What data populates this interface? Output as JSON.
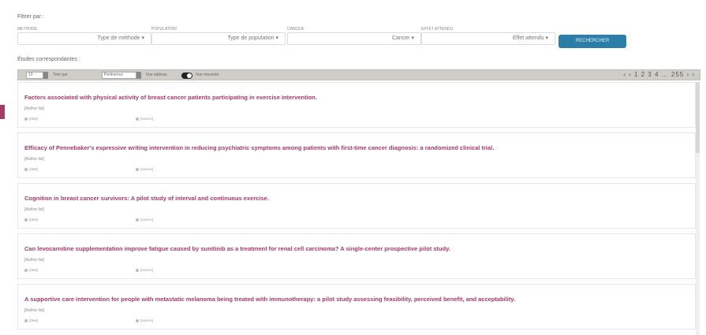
{
  "filters": {
    "title": "Filtrer par :",
    "columns": [
      {
        "label": "METHODE",
        "select": "Type de méthode ▾"
      },
      {
        "label": "POPULATION",
        "select": "Type de population ▾"
      },
      {
        "label": "CANCER",
        "select": "Cancer ▾"
      },
      {
        "label": "EFFET ATTENDU",
        "select": "Effet attendu ▾"
      }
    ],
    "search_button": "RECHERCHER"
  },
  "results": {
    "title": "Études correspondantes :",
    "toolbar": {
      "page_size": "10",
      "sort_label": "Trier par",
      "sort_value": "Pertinence",
      "toggle_label_left": "Vue tableau",
      "toggle_label_right": "Vue résumée",
      "pager": "‹ ‹  1 2 3 4 … 255  › ›"
    },
    "items": [
      {
        "title": "Factors associated with physical activity of breast cancer patients participating in exercise intervention.",
        "authors": "[Author list]",
        "date": "[date]",
        "source": "[source]"
      },
      {
        "title": "Efficacy of Pennebaker's expressive writing intervention in reducing psychiatric symptoms among patients with first-time cancer diagnosis: a randomized clinical trial.",
        "authors": "[Author list]",
        "date": "[date]",
        "source": "[source]"
      },
      {
        "title": "Cognition in breast cancer survivors: A pilot study of interval and continuous exercise.",
        "authors": "[Author list]",
        "date": "[date]",
        "source": "[source]"
      },
      {
        "title": "Can levocarnitine supplementation improve fatigue caused by sunitinib as a treatment for renal cell carcinoma? A single-center prospective pilot study.",
        "authors": "[Author list]",
        "date": "[date]",
        "source": "[source]"
      },
      {
        "title": "A supportive care intervention for people with metastatic melanoma being treated with immunotherapy: a pilot study assessing feasibility, perceived benefit, and acceptability.",
        "authors": "[Author list]",
        "date": "[date]",
        "source": "[source]"
      }
    ]
  }
}
